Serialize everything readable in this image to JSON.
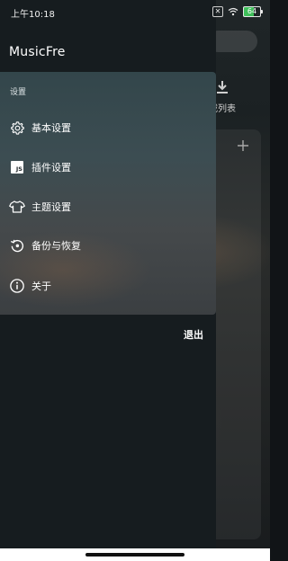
{
  "status_bar": {
    "time": "上午10:18",
    "battery": "64"
  },
  "background": {
    "download_label": "载列表"
  },
  "drawer": {
    "app_title": "MusicFre",
    "section_header": "设置",
    "items": [
      {
        "label": "基本设置",
        "icon": "gear-icon"
      },
      {
        "label": "插件设置",
        "icon": "js-icon"
      },
      {
        "label": "主题设置",
        "icon": "shirt-icon"
      },
      {
        "label": "备份与恢复",
        "icon": "backup-restore-icon"
      },
      {
        "label": "关于",
        "icon": "info-icon"
      }
    ],
    "exit_label": "退出"
  },
  "colors": {
    "drawer_bg": "#161c1f",
    "panel_top": "#33464b",
    "panel_bottom": "#3b3f42",
    "text": "#ffffff"
  }
}
